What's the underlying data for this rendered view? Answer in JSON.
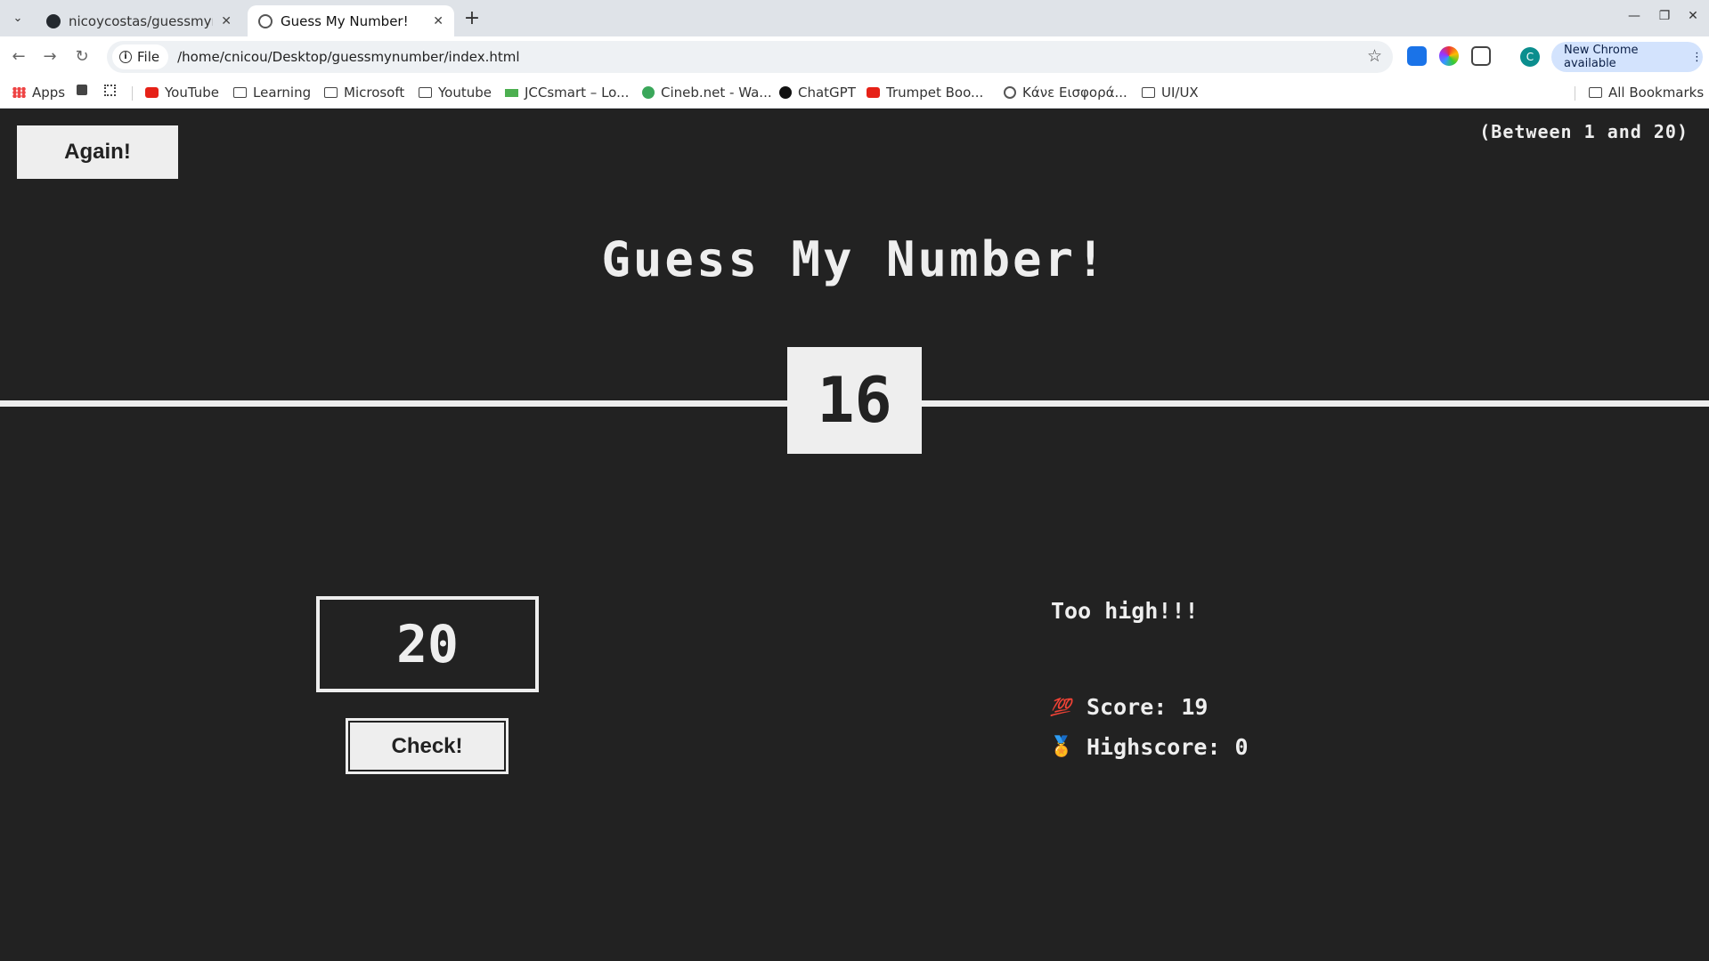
{
  "browser": {
    "tabs": [
      {
        "title": "nicoycostas/guessmynu",
        "active": false,
        "icon": "github-icon"
      },
      {
        "title": "Guess My Number!",
        "active": true,
        "icon": "globe-icon"
      }
    ],
    "omnibox": {
      "scheme_label": "File",
      "url": "/home/cnicou/Desktop/guessmynumber/index.html"
    },
    "profile_initial": "C",
    "update_label": "New Chrome available",
    "bookmarks": [
      {
        "label": "Apps",
        "icon": "apps-grid-icon"
      },
      {
        "label": "YouTube",
        "icon": "youtube-icon"
      },
      {
        "label": "Learning",
        "icon": "folder-icon"
      },
      {
        "label": "Microsoft",
        "icon": "folder-icon"
      },
      {
        "label": "Youtube",
        "icon": "folder-icon"
      },
      {
        "label": "JCCsmart – Lo...",
        "icon": "jcc-icon"
      },
      {
        "label": "Cineb.net - Wa...",
        "icon": "cineb-icon"
      },
      {
        "label": "ChatGPT",
        "icon": "chatgpt-icon"
      },
      {
        "label": "Trumpet Boo...",
        "icon": "youtube-icon"
      },
      {
        "label": "Κάνε Εισφορά...",
        "icon": "globe-icon"
      },
      {
        "label": "UI/UX",
        "icon": "folder-icon"
      }
    ],
    "all_bookmarks_label": "All Bookmarks"
  },
  "game": {
    "again_label": "Again!",
    "range_text": "(Between 1 and 20)",
    "title": "Guess My Number!",
    "secret_number": "16",
    "guess_value": "20",
    "check_label": "Check!",
    "message": "Too high!!!",
    "score": {
      "icon": "hundred-points-icon",
      "label": "Score:",
      "value": "19"
    },
    "highscore": {
      "icon": "medal-icon",
      "label": "Highscore:",
      "value": "0"
    }
  },
  "colors": {
    "background": "#222222",
    "foreground": "#eeeeee",
    "update_button": "#d3e3fd"
  }
}
